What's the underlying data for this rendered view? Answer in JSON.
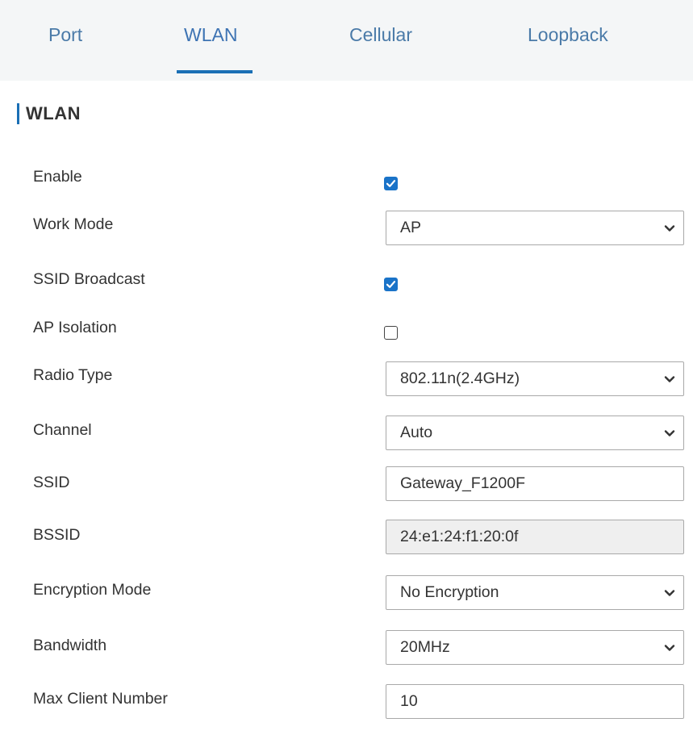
{
  "tabs": [
    {
      "label": "Port",
      "active": false
    },
    {
      "label": "WLAN",
      "active": true
    },
    {
      "label": "Cellular",
      "active": false
    },
    {
      "label": "Loopback",
      "active": false
    }
  ],
  "section": {
    "title": "WLAN"
  },
  "colors": {
    "accent": "#1a6fb5",
    "tab_text": "#4a7aa8",
    "tab_bar_bg": "#f4f6f7",
    "checkbox_checked": "#1a73c8",
    "readonly_bg": "#efefef"
  },
  "form": {
    "enable": {
      "label": "Enable",
      "checked": true
    },
    "work_mode": {
      "label": "Work Mode",
      "value": "AP"
    },
    "ssid_broadcast": {
      "label": "SSID Broadcast",
      "checked": true
    },
    "ap_isolation": {
      "label": "AP Isolation",
      "checked": false
    },
    "radio_type": {
      "label": "Radio Type",
      "value": "802.11n(2.4GHz)"
    },
    "channel": {
      "label": "Channel",
      "value": "Auto"
    },
    "ssid": {
      "label": "SSID",
      "value": "Gateway_F1200F"
    },
    "bssid": {
      "label": "BSSID",
      "value": "24:e1:24:f1:20:0f"
    },
    "encryption_mode": {
      "label": "Encryption Mode",
      "value": "No Encryption"
    },
    "bandwidth": {
      "label": "Bandwidth",
      "value": "20MHz"
    },
    "max_client_number": {
      "label": "Max Client Number",
      "value": "10"
    }
  },
  "icons": {
    "dropdown": "chevron-down-icon",
    "check": "checkmark-icon"
  }
}
